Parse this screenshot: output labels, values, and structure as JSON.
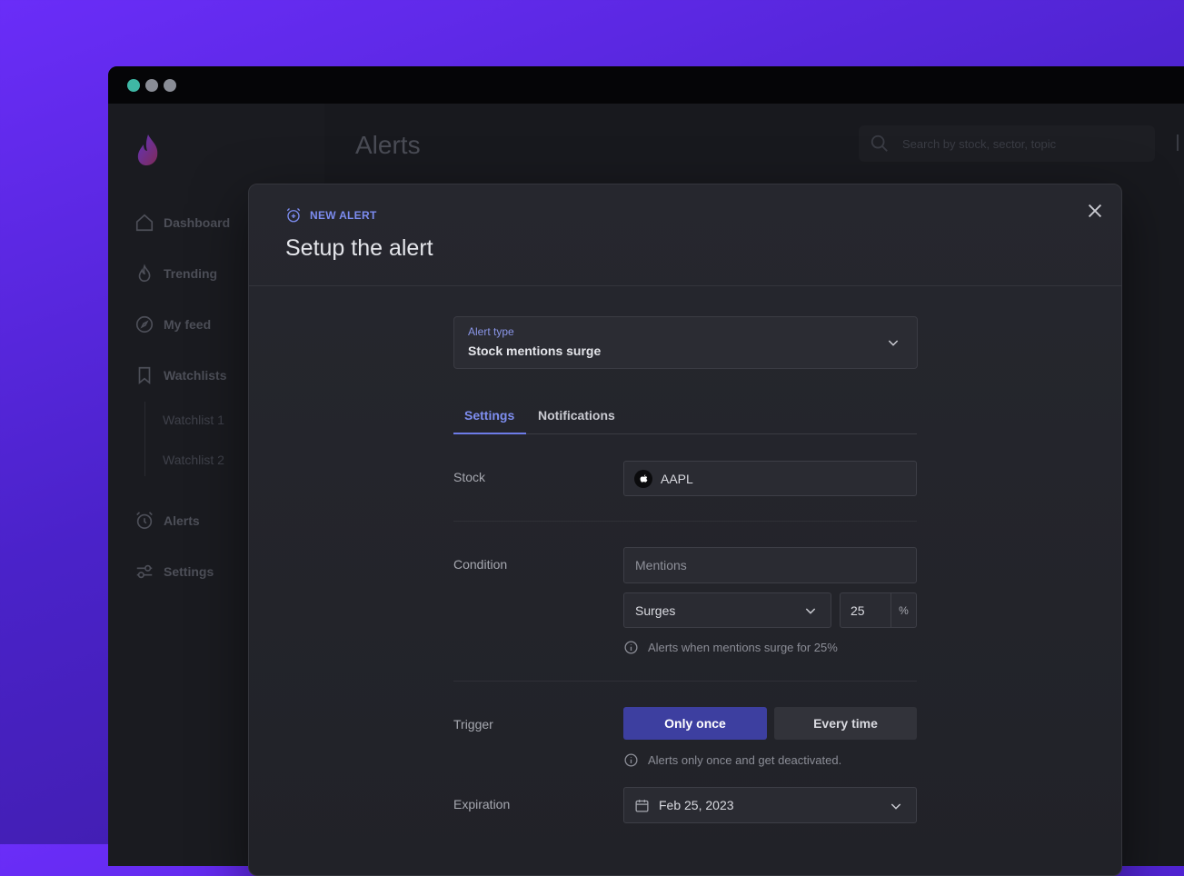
{
  "app": {
    "page_title": "Alerts",
    "search_placeholder": "Search by stock, sector, topic"
  },
  "sidebar": {
    "items": [
      {
        "label": "Dashboard",
        "icon": "home-icon"
      },
      {
        "label": "Trending",
        "icon": "flame-icon"
      },
      {
        "label": "My feed",
        "icon": "compass-icon"
      },
      {
        "label": "Watchlists",
        "icon": "bookmark-icon"
      },
      {
        "label": "Alerts",
        "icon": "alarm-icon"
      },
      {
        "label": "Settings",
        "icon": "sliders-icon"
      }
    ],
    "watchlists": [
      "Watchlist 1",
      "Watchlist 2"
    ]
  },
  "modal": {
    "eyebrow": "NEW ALERT",
    "title": "Setup the alert",
    "alert_type": {
      "label": "Alert type",
      "value": "Stock mentions surge"
    },
    "tabs": [
      {
        "label": "Settings",
        "active": true
      },
      {
        "label": "Notifications",
        "active": false
      }
    ],
    "stock": {
      "label": "Stock",
      "value": "AAPL"
    },
    "condition": {
      "label": "Condition",
      "metric_placeholder": "Mentions",
      "operator": "Surges",
      "amount": "25",
      "unit": "%",
      "hint": "Alerts when mentions surge for 25%"
    },
    "trigger": {
      "label": "Trigger",
      "options": [
        "Only once",
        "Every time"
      ],
      "selected": "Only once",
      "hint": "Alerts only once and get deactivated."
    },
    "expiration": {
      "label": "Expiration",
      "value": "Feb 25, 2023"
    }
  },
  "colors": {
    "accent": "#7c8cf0",
    "primary_button": "#3d3fa0",
    "background_gradient_start": "#6a2df8"
  }
}
